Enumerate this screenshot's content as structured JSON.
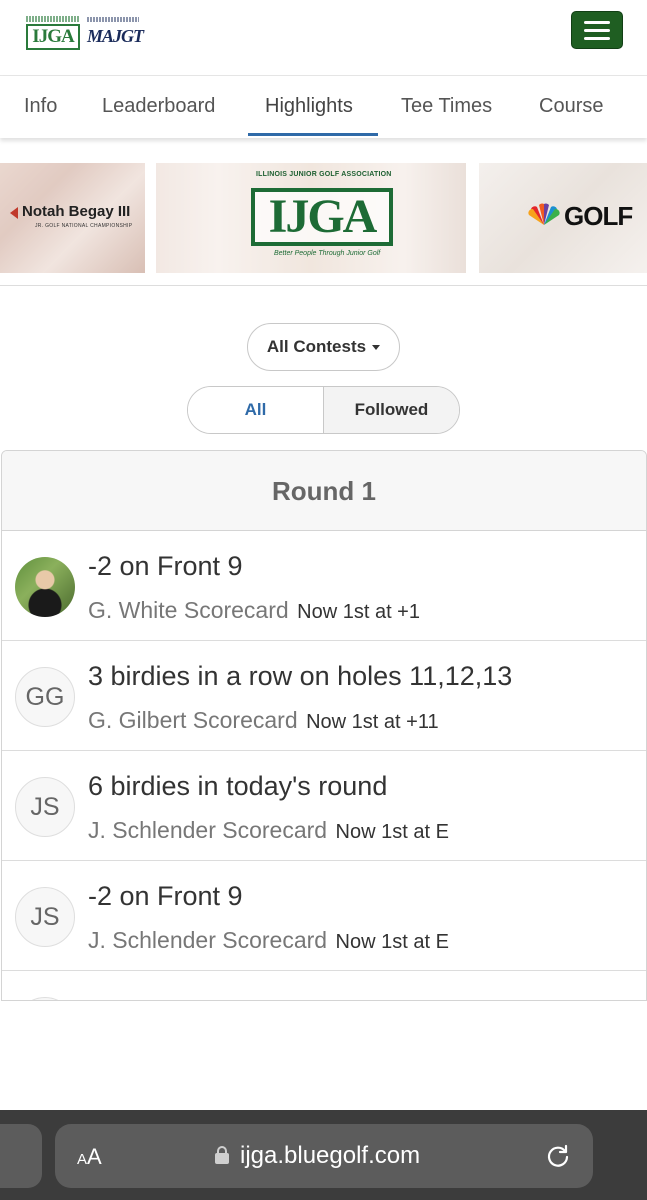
{
  "header": {
    "logo_left": "IJGA",
    "logo_right": "MAJGT",
    "menu_icon": "hamburger-icon",
    "menu_color": "#1f5e22"
  },
  "tabs": [
    {
      "label": "Info",
      "active": false
    },
    {
      "label": "Leaderboard",
      "active": false
    },
    {
      "label": "Highlights",
      "active": true
    },
    {
      "label": "Tee Times",
      "active": false
    },
    {
      "label": "Course",
      "active": false
    }
  ],
  "sponsors": {
    "notah": {
      "name": "Notah Begay III",
      "sub": "JR. GOLF NATIONAL CHAMPIONSHIP"
    },
    "ijga": {
      "top": "ILLINOIS JUNIOR GOLF ASSOCIATION",
      "logo": "IJGA",
      "tagline": "Better People Through Junior Golf"
    },
    "nbc": {
      "text": "GOLF"
    }
  },
  "filters": {
    "contest_dropdown": "All Contests",
    "segment_all": "All",
    "segment_followed": "Followed",
    "active_segment": "All"
  },
  "panel": {
    "round_title": "Round 1",
    "rows": [
      {
        "avatar": "",
        "avatar_type": "photo",
        "title": "-2 on Front 9",
        "name": "G. White Scorecard",
        "status": "Now 1st at +1"
      },
      {
        "avatar": "GG",
        "avatar_type": "initials",
        "title": "3 birdies in a row on holes 11,12,13",
        "name": "G. Gilbert Scorecard",
        "status": "Now 1st at +11"
      },
      {
        "avatar": "JS",
        "avatar_type": "initials",
        "title": "6 birdies in today's round",
        "name": "J. Schlender Scorecard",
        "status": "Now 1st at E"
      },
      {
        "avatar": "JS",
        "avatar_type": "initials",
        "title": "-2 on Front 9",
        "name": "J. Schlender Scorecard",
        "status": "Now 1st at E"
      }
    ]
  },
  "browser": {
    "text_size_label_big": "A",
    "text_size_label_small": "A",
    "url": "ijga.bluegolf.com"
  }
}
